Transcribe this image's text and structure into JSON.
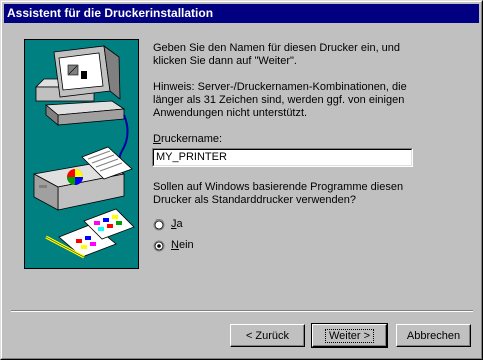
{
  "window": {
    "title": "Assistent für die Druckerinstallation"
  },
  "intro": {
    "line1": "Geben Sie den Namen für diesen Drucker ein, und",
    "line2": "klicken Sie dann auf \"Weiter\"."
  },
  "hint": {
    "line1": "Hinweis: Server-/Druckernamen-Kombinationen, die",
    "line2": "länger als 31 Zeichen sind, werden ggf. von einigen",
    "line3": "Anwendungen nicht unterstützt."
  },
  "printer_name": {
    "label": "Druckername:",
    "value": "MY_PRINTER"
  },
  "default_question": {
    "line1": "Sollen auf Windows basierende Programme diesen",
    "line2": "Drucker als Standarddrucker verwenden?"
  },
  "options": {
    "yes": "Ja",
    "no": "Nein",
    "selected": "no"
  },
  "buttons": {
    "back": "< Zurück",
    "next": "Weiter >",
    "cancel": "Abbrechen"
  },
  "colors": {
    "titlebar": "#000080",
    "panel": "#008080",
    "face": "#c0c0c0"
  },
  "icons": {
    "illustration": "computer-printer-illustration"
  }
}
